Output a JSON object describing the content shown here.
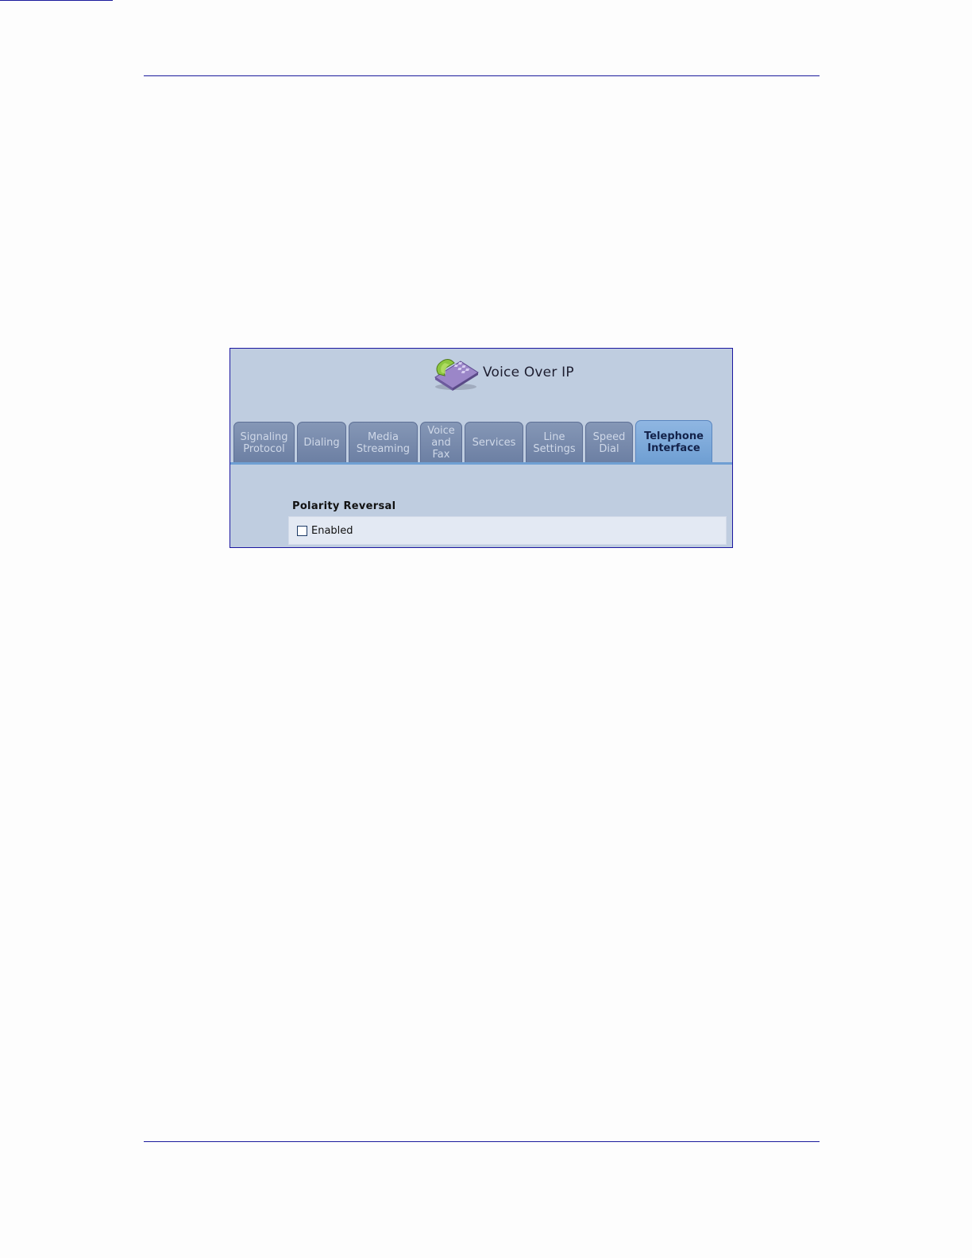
{
  "window": {
    "title": "Voice Over IP",
    "icon": "voip-phone-icon"
  },
  "tabs": [
    {
      "label": "Signaling\nProtocol",
      "active": false
    },
    {
      "label": "Dialing",
      "active": false
    },
    {
      "label": "Media\nStreaming",
      "active": false
    },
    {
      "label": "Voice\nand\nFax",
      "active": false
    },
    {
      "label": "Services",
      "active": false
    },
    {
      "label": "Line\nSettings",
      "active": false
    },
    {
      "label": "Speed\nDial",
      "active": false
    },
    {
      "label": "Telephone\nInterface",
      "active": true
    }
  ],
  "section": {
    "title": "Polarity Reversal",
    "checkbox_label": "Enabled",
    "checked": false
  },
  "colors": {
    "rule": "#1a1a9c",
    "panel_bg": "#bfcde0",
    "tab_inactive": "#7a8cae",
    "tab_active": "#7faadb"
  }
}
